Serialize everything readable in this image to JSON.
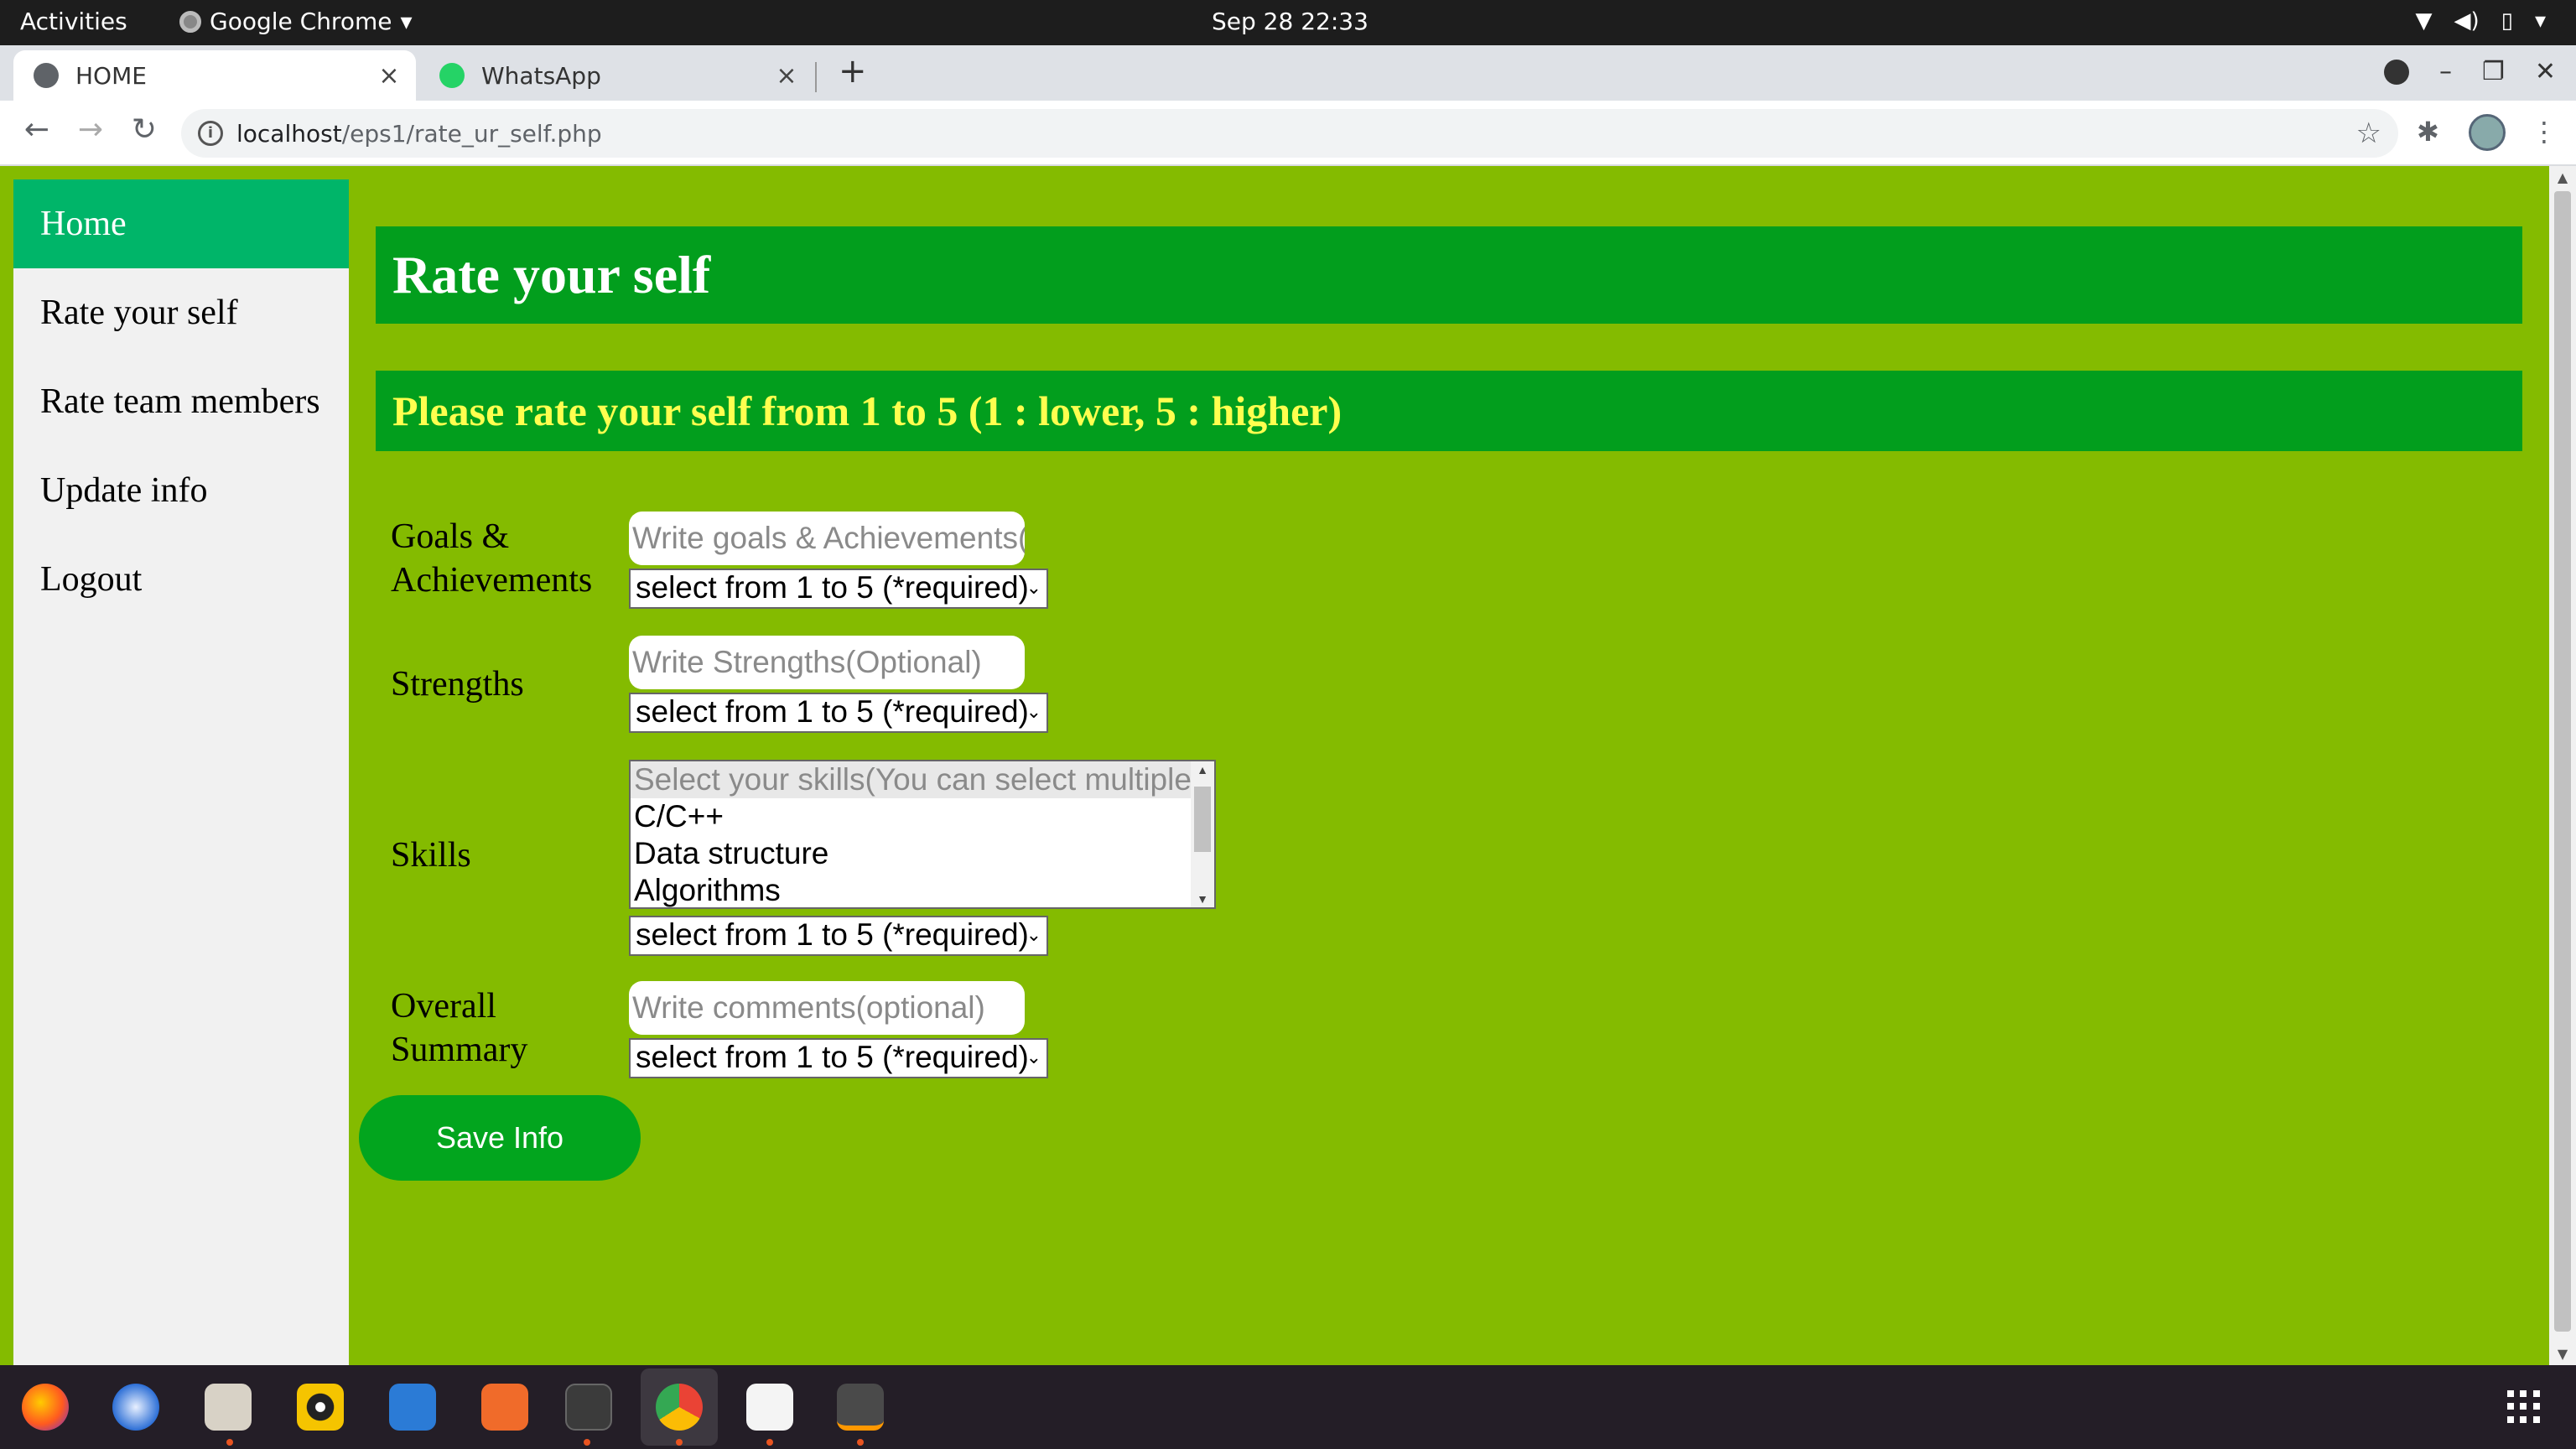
{
  "system": {
    "activities": "Activities",
    "app_name": "Google Chrome",
    "app_menu_icon": "caret-down-icon",
    "clock": "Sep 28  22:33",
    "tray_icons": [
      "wifi-icon",
      "volume-icon",
      "battery-icon",
      "caret-down-icon"
    ]
  },
  "browser": {
    "tabs": [
      {
        "title": "HOME",
        "icon": "globe-icon",
        "active": true
      },
      {
        "title": "WhatsApp",
        "icon": "whatsapp-icon",
        "active": false
      }
    ],
    "tab_close": "×",
    "new_tab": "+",
    "url_host": "localhost",
    "url_path": "/eps1/rate_ur_self.php",
    "nav": {
      "back": "←",
      "forward": "→",
      "reload": "↻"
    },
    "star": "☆",
    "menu": "⋮",
    "window": {
      "minimize": "–",
      "maximize": "❐",
      "close": "✕"
    }
  },
  "sidebar": {
    "items": [
      {
        "label": "Home",
        "active": true
      },
      {
        "label": "Rate your self",
        "active": false
      },
      {
        "label": "Rate team members",
        "active": false
      },
      {
        "label": "Update info",
        "active": false
      },
      {
        "label": "Logout",
        "active": false
      }
    ]
  },
  "page": {
    "title": "Rate your self",
    "subtitle": "Please rate your self from 1 to 5 (1 : lower, 5 : higher)",
    "fields": {
      "goals": {
        "label_line1": "Goals &",
        "label_line2": "Achievements",
        "placeholder": "Write goals & Achievements(optional)",
        "select": "select from 1 to 5 (*required)"
      },
      "strengths": {
        "label": "Strengths",
        "placeholder": "Write Strengths(Optional)",
        "select": "select from 1 to 5 (*required)"
      },
      "skills": {
        "label": "Skills",
        "options": [
          "Select your skills(You can select multiple)",
          "C/C++",
          "Data structure",
          "Algorithms"
        ],
        "select": "select from 1 to 5 (*required)"
      },
      "summary": {
        "label_line1": "Overall",
        "label_line2": "Summary",
        "placeholder": "Write comments(optional)",
        "select": "select from 1 to 5 (*required)"
      }
    },
    "save_button": "Save Info"
  },
  "colors": {
    "page_bg": "#84bb00",
    "header_bg": "#029e1d",
    "subtitle_text": "#ffff4f",
    "nav_active": "#00b569",
    "button_bg": "#02a51e"
  },
  "dock": {
    "icons": [
      "firefox-icon",
      "thunderbird-icon",
      "files-icon",
      "rhythmbox-icon",
      "writer-icon",
      "software-center-icon",
      "terminal-icon",
      "chrome-icon",
      "text-editor-icon",
      "sublime-text-icon"
    ],
    "apps_grid": "show-applications-icon"
  }
}
